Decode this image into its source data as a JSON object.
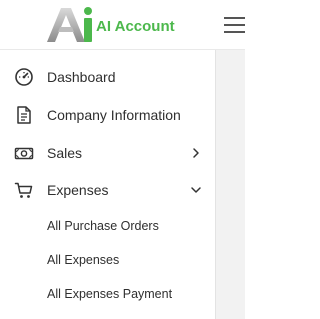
{
  "brand": {
    "name": "AI Account",
    "logo_letters": "Ai",
    "accent_color": "#4cb84c"
  },
  "header": {
    "menu_icon": "hamburger-icon"
  },
  "sidebar": {
    "items": [
      {
        "label": "Dashboard",
        "icon": "speedometer-icon"
      },
      {
        "label": "Company Information",
        "icon": "document-icon"
      },
      {
        "label": "Sales",
        "icon": "money-icon",
        "chevron": "chevron-right-icon"
      },
      {
        "label": "Expenses",
        "icon": "cart-icon",
        "chevron": "chevron-down-icon",
        "expanded": true
      }
    ],
    "sub_items": [
      {
        "label": "All Purchase Orders"
      },
      {
        "label": "All Expenses"
      },
      {
        "label": "All Expenses Payment"
      }
    ]
  }
}
